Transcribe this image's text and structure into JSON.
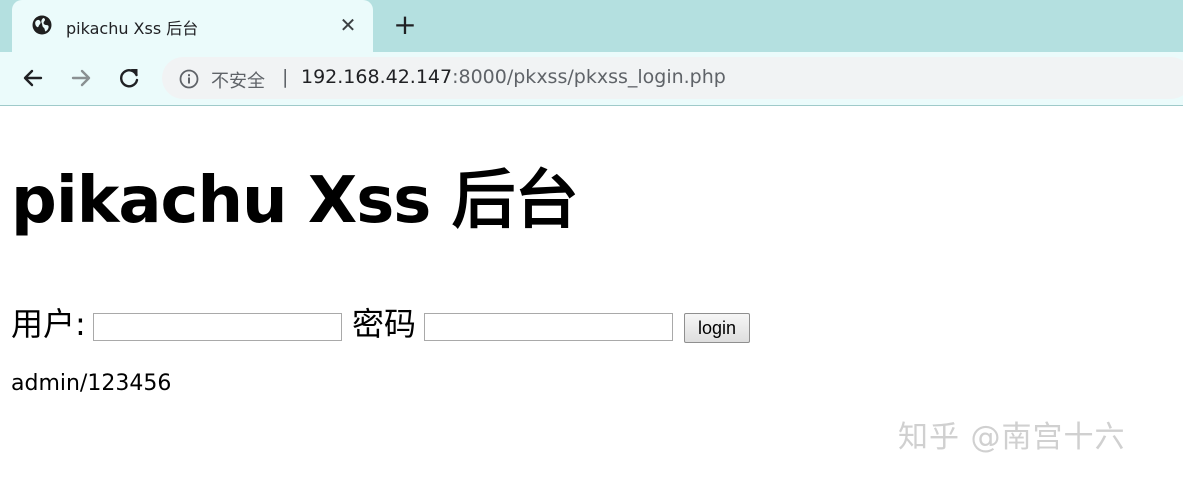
{
  "browser": {
    "tab": {
      "title": "pikachu Xss 后台",
      "close_symbol": "✕"
    },
    "new_tab_symbol": "+",
    "nav": {
      "back_icon": "back-arrow-icon",
      "forward_icon": "forward-arrow-icon",
      "reload_icon": "reload-icon"
    },
    "omnibox": {
      "security_label": "不安全",
      "separator": "|",
      "host": "192.168.42.147",
      "rest": ":8000/pkxss/pkxss_login.php"
    },
    "colors": {
      "tabstrip": "#b4e0e0",
      "toolbar": "#ebfbfb",
      "omnibox": "#f1f3f4"
    }
  },
  "page": {
    "title": "pikachu Xss 后台",
    "form": {
      "user_label": "用户:",
      "user_value": "",
      "password_label": "密码",
      "password_value": "",
      "login_label": "login"
    },
    "hint": "admin/123456"
  },
  "watermark": "知乎 @南宫十六"
}
